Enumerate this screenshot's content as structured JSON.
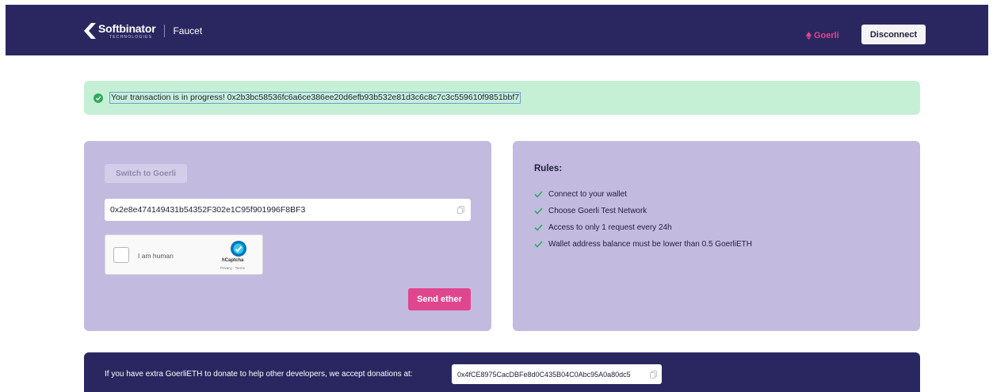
{
  "header": {
    "logo_name": "Softbinator",
    "logo_sub": "TECHNOLOGIES",
    "app_name": "Faucet",
    "network": "Goerli",
    "disconnect_label": "Disconnect"
  },
  "alert": {
    "text": "Your transaction is in progress! 0x2b3bc58536fc6a6ce386ee20d6efb93b532e81d3c6c8c7c3c559610f9851bbf7"
  },
  "form": {
    "switch_label": "Switch to Goerli",
    "wallet_address": "0x2e8e474149431b54352F302e1C95f901996F8BF3",
    "captcha_label": "I am human",
    "captcha_brand": "hCaptcha",
    "captcha_links": "Privacy - Terms",
    "send_label": "Send ether"
  },
  "rules": {
    "title": "Rules:",
    "items": [
      "Connect to your wallet",
      "Choose Goerli Test Network",
      "Access to only 1 request every 24h",
      "Wallet address balance must be lower than 0.5 GoerliETH"
    ]
  },
  "donate": {
    "text": "If you have extra GoerliETH to donate to help other developers, we accept donations at:",
    "address": "0x4fCE8975CacDBFe8d0C435B04C0Abc95A0a80dc5"
  },
  "colors": {
    "navy": "#2a2760",
    "pink": "#e0468e",
    "card": "#c3bae0",
    "success_bg": "#c6f0d6",
    "success_icon": "#2ea95e"
  }
}
